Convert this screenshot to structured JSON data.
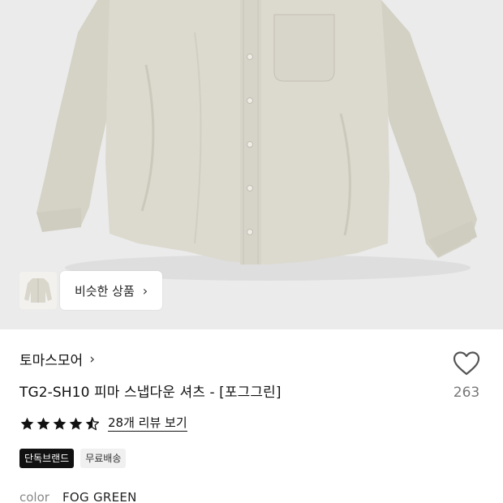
{
  "hero": {
    "similar_label": "비슷한 상품",
    "similar_chevron": "chevron-right-icon"
  },
  "product": {
    "brand": "토마스모어",
    "brand_chevron": "chevron-right-icon",
    "title": "TG2-SH10 피마 스냅다운 셔츠 - [포그그린]",
    "likes": "263",
    "rating": 4.5,
    "review_link": "28개 리뷰 보기",
    "badges": [
      "단독브랜드",
      "무료배송"
    ],
    "color_label": "color",
    "color_value": "FOG GREEN"
  },
  "colors": {
    "hero_bg": "#ebebeb",
    "shirt": "#d9d6cb",
    "star": "#111111",
    "badge_dark": "#111111",
    "badge_light": "#f0f0f0"
  }
}
